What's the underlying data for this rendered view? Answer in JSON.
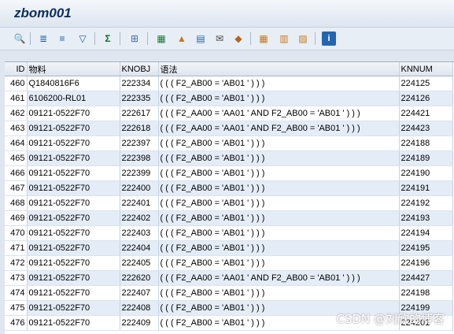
{
  "window": {
    "title": "zbom001"
  },
  "toolbar": {
    "icons": [
      "details-icon",
      "sort-ascending-icon",
      "sort-descending-icon",
      "filter-icon",
      "sum-icon",
      "subtotal-icon",
      "print-preview-icon",
      "export-excel-icon",
      "word-processing-icon",
      "local-file-icon",
      "send-icon",
      "abc-analysis-icon",
      "change-layout-icon",
      "select-layout-icon",
      "save-layout-icon",
      "information-icon"
    ]
  },
  "table": {
    "headers": [
      "ID",
      "物料",
      "KNOBJ",
      "语法",
      "KNNUM"
    ],
    "rows": [
      [
        "460",
        "Q1840816F6",
        "222334",
        "( ( ( F2_AB00 = 'AB01 ' ) ) )",
        "224125"
      ],
      [
        "461",
        "6106200-RL01",
        "222335",
        "( ( ( F2_AB00 = 'AB01 ' ) ) )",
        "224126"
      ],
      [
        "462",
        "09121-0522F70",
        "222617",
        "( ( ( F2_AA00 = 'AA01 ' AND F2_AB00 = 'AB01 ' ) ) )",
        "224421"
      ],
      [
        "463",
        "09121-0522F70",
        "222618",
        "( ( ( F2_AA00 = 'AA01 ' AND F2_AB00 = 'AB01 ' ) ) )",
        "224423"
      ],
      [
        "464",
        "09121-0522F70",
        "222397",
        "( ( ( F2_AB00 = 'AB01 ' ) ) )",
        "224188"
      ],
      [
        "465",
        "09121-0522F70",
        "222398",
        "( ( ( F2_AB00 = 'AB01 ' ) ) )",
        "224189"
      ],
      [
        "466",
        "09121-0522F70",
        "222399",
        "( ( ( F2_AB00 = 'AB01 ' ) ) )",
        "224190"
      ],
      [
        "467",
        "09121-0522F70",
        "222400",
        "( ( ( F2_AB00 = 'AB01 ' ) ) )",
        "224191"
      ],
      [
        "468",
        "09121-0522F70",
        "222401",
        "( ( ( F2_AB00 = 'AB01 ' ) ) )",
        "224192"
      ],
      [
        "469",
        "09121-0522F70",
        "222402",
        "( ( ( F2_AB00 = 'AB01 ' ) ) )",
        "224193"
      ],
      [
        "470",
        "09121-0522F70",
        "222403",
        "( ( ( F2_AB00 = 'AB01 ' ) ) )",
        "224194"
      ],
      [
        "471",
        "09121-0522F70",
        "222404",
        "( ( ( F2_AB00 = 'AB01 ' ) ) )",
        "224195"
      ],
      [
        "472",
        "09121-0522F70",
        "222405",
        "( ( ( F2_AB00 = 'AB01 ' ) ) )",
        "224196"
      ],
      [
        "473",
        "09121-0522F70",
        "222620",
        "( ( ( F2_AA00 = 'AA01 ' AND F2_AB00 = 'AB01 ' ) ) )",
        "224427"
      ],
      [
        "474",
        "09121-0522F70",
        "222407",
        "( ( ( F2_AB00 = 'AB01 ' ) ) )",
        "224198"
      ],
      [
        "475",
        "09121-0522F70",
        "222408",
        "( ( ( F2_AB00 = 'AB01 ' ) ) )",
        "224199"
      ],
      [
        "476",
        "09121-0522F70",
        "222409",
        "( ( ( F2_AB00 = 'AB01 ' ) ) )",
        "224201"
      ]
    ]
  },
  "watermark": "CSDN @刘欣的博客"
}
